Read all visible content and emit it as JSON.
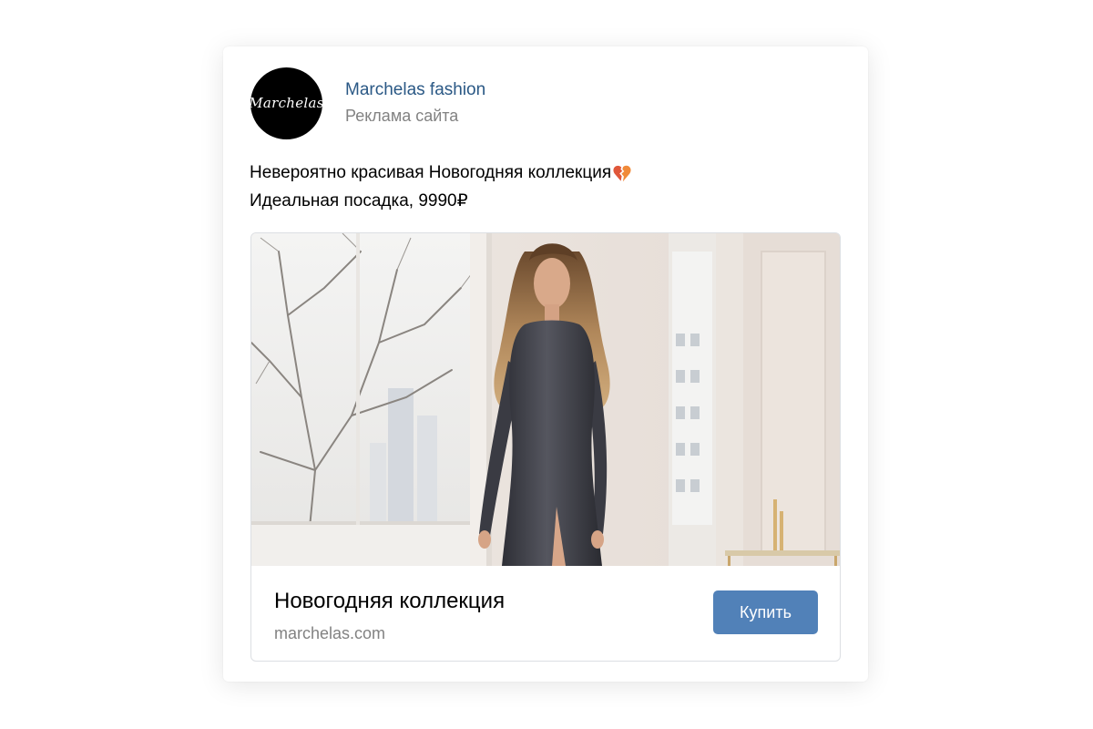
{
  "post": {
    "author": {
      "name": "Marchelas fashion",
      "subtitle": "Реклама сайта",
      "avatar_text": "Marchelas"
    },
    "text_lines": [
      "Невероятно красивая Новогодняя коллекция",
      "Идеальная посадка, 9990₽"
    ],
    "emoji": "broken-heart-icon"
  },
  "snippet": {
    "title": "Новогодняя коллекция",
    "domain": "marchelas.com",
    "button_label": "Купить"
  },
  "colors": {
    "link": "#2a5885",
    "secondary_text": "#828282",
    "button": "#5181b8"
  }
}
